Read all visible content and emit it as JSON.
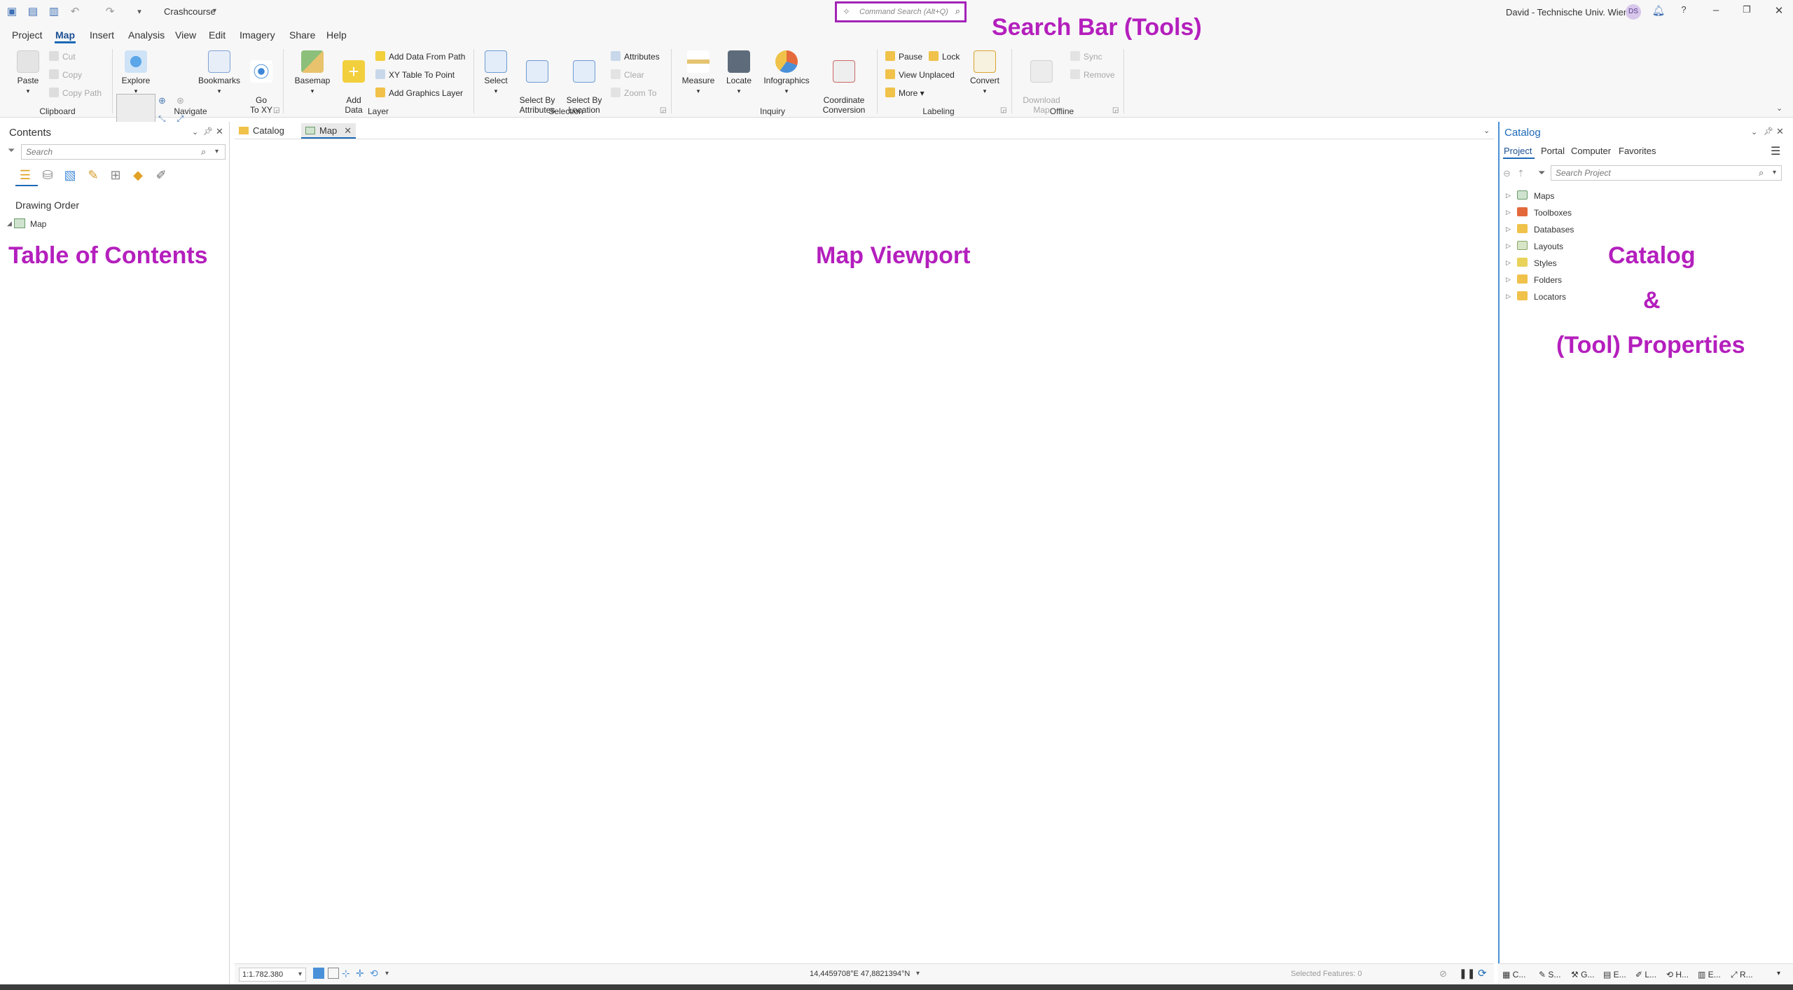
{
  "titlebar": {
    "project_name": "Crashcourse",
    "command_search_placeholder": "Command Search (Alt+Q)",
    "user_label": "David - Technische Univ. Wien",
    "avatar_initials": "DS"
  },
  "menu": {
    "items": [
      "Project",
      "Map",
      "Insert",
      "Analysis",
      "View",
      "Edit",
      "Imagery",
      "Share",
      "Help"
    ],
    "active": "Map"
  },
  "ribbon": {
    "clipboard": {
      "group": "Clipboard",
      "paste": "Paste",
      "cut": "Cut",
      "copy": "Copy",
      "copy_path": "Copy Path"
    },
    "navigate": {
      "group": "Navigate",
      "explore": "Explore",
      "bookmarks": "Bookmarks",
      "go_to_xy": "Go\nTo XY"
    },
    "layer": {
      "group": "Layer",
      "basemap": "Basemap",
      "add_data": "Add\nData",
      "add_data_from_path": "Add Data From Path",
      "xy_table_to_point": "XY Table To Point",
      "add_graphics_layer": "Add Graphics Layer"
    },
    "selection": {
      "group": "Selection",
      "select": "Select",
      "select_by_attributes": "Select By\nAttributes",
      "select_by_location": "Select By\nLocation",
      "attributes": "Attributes",
      "clear": "Clear",
      "zoom_to": "Zoom To"
    },
    "inquiry": {
      "group": "Inquiry",
      "measure": "Measure",
      "locate": "Locate",
      "infographics": "Infographics",
      "coordinate_conversion": "Coordinate\nConversion"
    },
    "labeling": {
      "group": "Labeling",
      "pause": "Pause",
      "lock": "Lock",
      "view_unplaced": "View Unplaced",
      "more": "More",
      "convert": "Convert"
    },
    "offline": {
      "group": "Offline",
      "download_map": "Download\nMap",
      "sync": "Sync",
      "remove": "Remove"
    }
  },
  "contents": {
    "title": "Contents",
    "search_placeholder": "Search",
    "drawing_order": "Drawing Order",
    "layers": [
      "Map"
    ]
  },
  "doc_tabs": [
    "Catalog",
    "Map"
  ],
  "status": {
    "scale": "1:1.782.380",
    "coordinates": "14,4459708°E 47,8821394°N",
    "selected_features": "Selected Features: 0"
  },
  "catalog": {
    "title": "Catalog",
    "tabs": [
      "Project",
      "Portal",
      "Computer",
      "Favorites"
    ],
    "search_placeholder": "Search Project",
    "items": [
      "Maps",
      "Toolboxes",
      "Databases",
      "Layouts",
      "Styles",
      "Folders",
      "Locators"
    ],
    "bottom_tabs": [
      "C...",
      "S...",
      "G...",
      "E...",
      "L...",
      "H...",
      "E...",
      "R..."
    ]
  },
  "annotations": {
    "search_bar": "Search Bar (Tools)",
    "table_of_contents": "Table of Contents",
    "map_viewport": "Map Viewport",
    "catalog_line1": "Catalog",
    "catalog_line2": "&",
    "catalog_line3": "(Tool) Properties"
  },
  "colors": {
    "annotation": "#b41fbd",
    "accent": "#1b69b7",
    "search_outline": "#a323b7"
  }
}
